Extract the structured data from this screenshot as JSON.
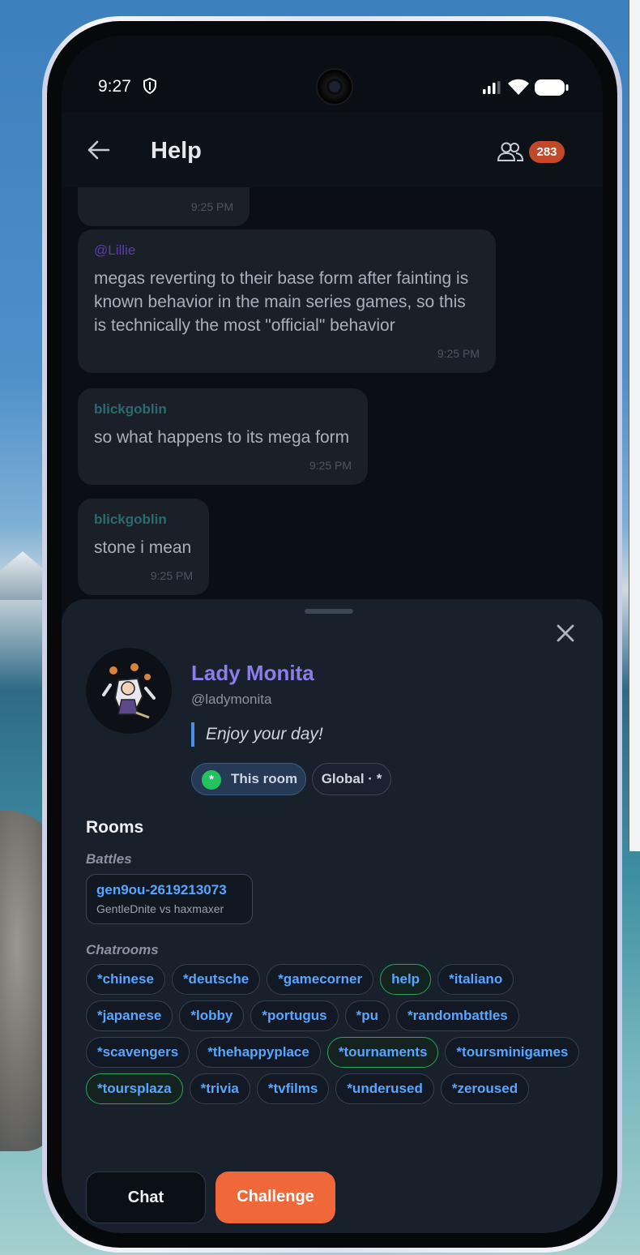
{
  "status_bar": {
    "time": "9:27"
  },
  "header": {
    "title": "Help",
    "user_count": "283"
  },
  "messages": [
    {
      "user": "",
      "text": "",
      "time": "9:25 PM"
    },
    {
      "user": "@Lillie",
      "text": "megas reverting to their base form after fainting is known behavior in the main series games, so this is technically the most \"official\" behavior",
      "time": "9:25 PM"
    },
    {
      "user": "blickgoblin",
      "text": "so what happens to its mega form",
      "time": "9:25 PM"
    },
    {
      "user": "blickgoblin",
      "text": "stone i mean",
      "time": "9:25 PM"
    }
  ],
  "profile": {
    "name": "Lady Monita",
    "handle": "@ladymonita",
    "status": "Enjoy your day!",
    "chip_this_room": "This room",
    "chip_this_room_symbol": "*",
    "chip_global": "Global · *"
  },
  "rooms": {
    "title": "Rooms",
    "battles_label": "Battles",
    "battle": {
      "id": "gen9ou-2619213073",
      "players": "GentleDnite vs haxmaxer"
    },
    "chatrooms_label": "Chatrooms",
    "rows": [
      [
        "*chinese",
        "*deutsche",
        "*gamecorner",
        "help",
        "*italiano"
      ],
      [
        "*japanese",
        "*lobby",
        "*portugus",
        "*pu",
        "*randombattles"
      ],
      [
        "*scavengers",
        "*thehappyplace",
        "*tournaments",
        "*toursminigames"
      ],
      [
        "*toursplaza",
        "*trivia",
        "*tvfilms",
        "*underused",
        "*zeroused"
      ]
    ],
    "active_rooms": [
      "help",
      "*tournaments",
      "*toursplaza"
    ]
  },
  "actions": {
    "chat": "Chat",
    "challenge": "Challenge"
  },
  "colors": {
    "accent_orange": "#f0673a",
    "link_blue": "#58a6ff",
    "name_purple": "#8b7ee8",
    "active_green": "#2ea35a",
    "badge_red": "#c2482a"
  },
  "icons": [
    "shield-icon",
    "signal-icon",
    "wifi-icon",
    "battery-icon",
    "back-arrow-icon",
    "users-icon",
    "close-icon"
  ]
}
